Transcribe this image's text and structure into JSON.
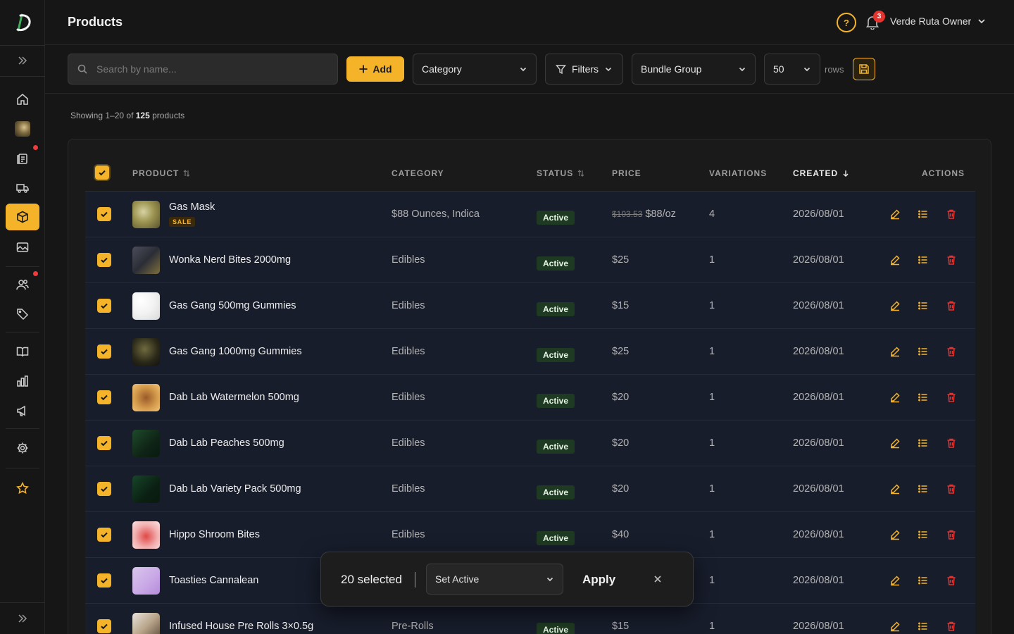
{
  "header": {
    "title": "Products",
    "help_label": "?",
    "notification_count": "3",
    "user_name": "Verde Ruta Owner"
  },
  "toolbar": {
    "search_placeholder": "Search by name...",
    "add_label": "Add",
    "category_label": "Category",
    "filters_label": "Filters",
    "bundle_group_label": "Bundle Group",
    "rows_value": "50",
    "rows_label": "rows"
  },
  "summary": {
    "prefix": "Showing 1–20 of",
    "total": "125",
    "suffix": "products"
  },
  "table": {
    "columns": {
      "product": "PRODUCT",
      "category": "CATEGORY",
      "status": "STATUS",
      "price": "PRICE",
      "variations": "VARIATIONS",
      "created": "CREATED",
      "actions": "ACTIONS"
    },
    "rows": [
      {
        "name": "Gas Mask",
        "badge": "SALE",
        "category": "$88 Ounces, Indica",
        "status": "Active",
        "price_old": "$103.53",
        "price": "$88/oz",
        "variations": "4",
        "created": "2026/08/01"
      },
      {
        "name": "Wonka Nerd Bites 2000mg",
        "category": "Edibles",
        "status": "Active",
        "price": "$25",
        "variations": "1",
        "created": "2026/08/01"
      },
      {
        "name": "Gas Gang 500mg Gummies",
        "category": "Edibles",
        "status": "Active",
        "price": "$15",
        "variations": "1",
        "created": "2026/08/01"
      },
      {
        "name": "Gas Gang 1000mg Gummies",
        "category": "Edibles",
        "status": "Active",
        "price": "$25",
        "variations": "1",
        "created": "2026/08/01"
      },
      {
        "name": "Dab Lab Watermelon 500mg",
        "category": "Edibles",
        "status": "Active",
        "price": "$20",
        "variations": "1",
        "created": "2026/08/01"
      },
      {
        "name": "Dab Lab Peaches 500mg",
        "category": "Edibles",
        "status": "Active",
        "price": "$20",
        "variations": "1",
        "created": "2026/08/01"
      },
      {
        "name": "Dab Lab Variety Pack 500mg",
        "category": "Edibles",
        "status": "Active",
        "price": "$20",
        "variations": "1",
        "created": "2026/08/01"
      },
      {
        "name": "Hippo Shroom Bites",
        "category": "Edibles",
        "status": "Active",
        "price": "$40",
        "variations": "1",
        "created": "2026/08/01"
      },
      {
        "name": "Toasties Cannalean",
        "category": "",
        "status": "",
        "price": "",
        "variations": "1",
        "created": "2026/08/01"
      },
      {
        "name": "Infused House Pre Rolls 3×0.5g",
        "category": "Pre-Rolls",
        "status": "Active",
        "price": "$15",
        "variations": "1",
        "created": "2026/08/01"
      }
    ]
  },
  "bulk": {
    "count": "20 selected",
    "action": "Set Active",
    "apply": "Apply"
  },
  "colors": {
    "accent": "#f5b329",
    "status_bg": "#1f3a22",
    "danger": "#e5342f"
  }
}
